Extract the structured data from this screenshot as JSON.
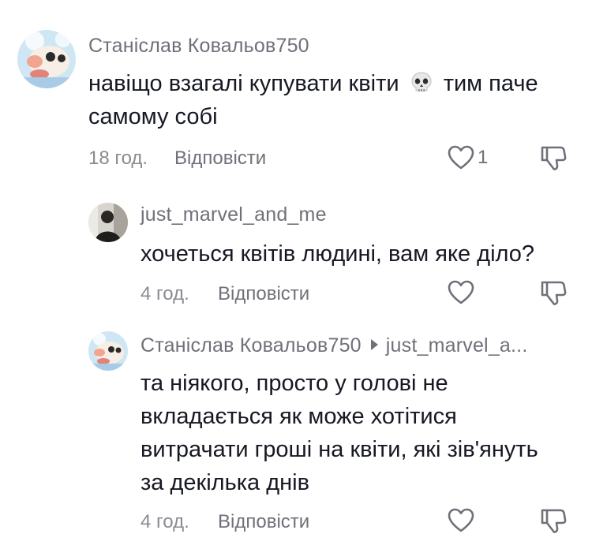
{
  "comments": [
    {
      "username": "Станіслав Ковальов750",
      "text_line1_before": "навіщо взагалі купувати квіти",
      "emoji": "skull-emoji",
      "text_line1_after": "тим паче",
      "text_line2": "самому собі",
      "time": "18 год.",
      "reply_label": "Відповісти",
      "likes": "1"
    },
    {
      "username": "just_marvel_and_me",
      "text_line1": "хочеться квітів людині, вам яке діло?",
      "time": "4 год.",
      "reply_label": "Відповісти"
    },
    {
      "username": "Станіслав Ковальов750",
      "reply_to": "just_marvel_a...",
      "text_lines": [
        "та ніякого, просто у голові не",
        "вкладається як може хотітися",
        "витрачати гроші на квіти, які зів'януть",
        "за декілька днів"
      ],
      "time": "4 год.",
      "reply_label": "Відповісти"
    }
  ],
  "icons": {
    "like": "heart-outline-icon",
    "dislike": "thumbs-down-outline-icon"
  },
  "colors": {
    "text": "#161823",
    "meta": "#8a8b91",
    "username": "#6f7079",
    "avatar_bg": "#cfe6f5"
  }
}
